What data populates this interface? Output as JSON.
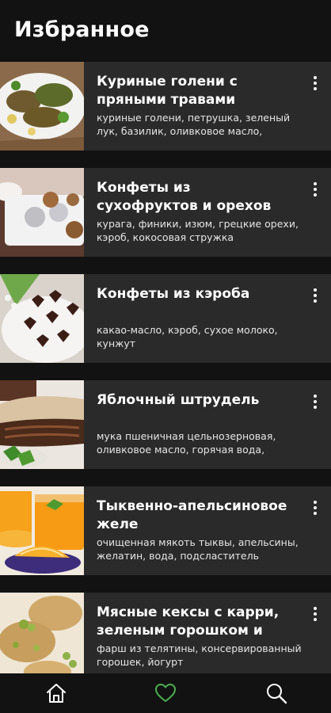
{
  "header": {
    "title": "Избранное"
  },
  "recipes": [
    {
      "title": "Куриные голени с пряными травами",
      "ingredients": "куриные голени, петрушка, зеленый лук, базилик, оливковое масло,"
    },
    {
      "title": "Конфеты из сухофруктов и орехов",
      "ingredients": "курага, финики, изюм, грецкие орехи, кэроб, кокосовая стружка"
    },
    {
      "title": "Конфеты из кэроба",
      "ingredients": "какао-масло, кэроб, сухое молоко, кунжут"
    },
    {
      "title": "Яблочный штрудель",
      "ingredients": "мука пшеничная цельнозерновая, оливковое масло, горячая вода,"
    },
    {
      "title": "Тыквенно-апельсиновое желе",
      "ingredients": "очищенная мякоть тыквы, апельсины, желатин, вода, подсластитель"
    },
    {
      "title": "Мясные кексы с карри, зеленым горошком и",
      "ingredients": "фарш из телятины, консервированный горошек, йогурт"
    }
  ],
  "nav": {
    "items": [
      {
        "name": "home",
        "icon": "home-icon",
        "active": false
      },
      {
        "name": "favorites",
        "icon": "heart-icon",
        "active": true
      },
      {
        "name": "search",
        "icon": "search-icon",
        "active": false
      }
    ]
  },
  "colors": {
    "background": "#121212",
    "card": "#2a2a2a",
    "active_tab": "#4caf50",
    "inactive_tab": "#ffffff"
  }
}
